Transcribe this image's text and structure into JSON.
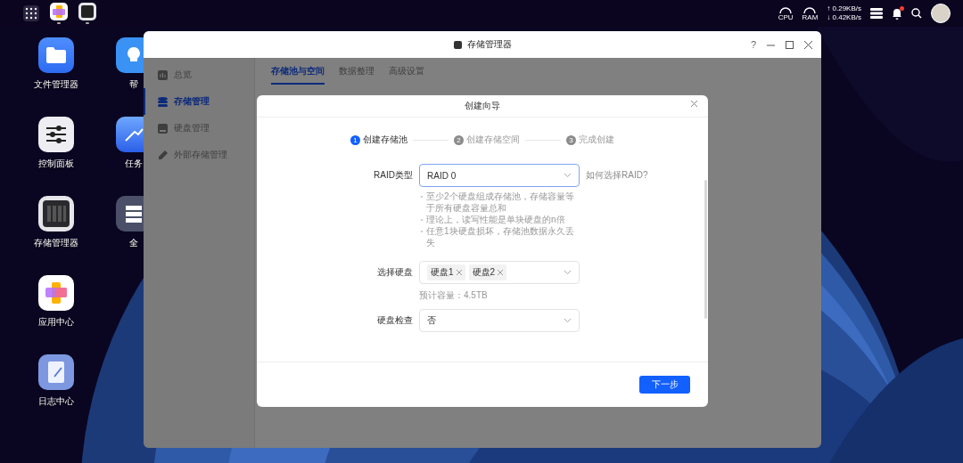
{
  "topbar": {
    "gauges": [
      {
        "label": "CPU"
      },
      {
        "label": "RAM"
      }
    ],
    "net_up": "↑ 0.29KB/s",
    "net_down": "↓ 0.42KB/s",
    "has_notification": true,
    "running_apps": [
      {
        "kind": "apps"
      },
      {
        "kind": "storage"
      }
    ]
  },
  "desktop_icons": [
    {
      "kind": "folder",
      "label": "文件管理器"
    },
    {
      "kind": "help",
      "label": "帮"
    },
    {
      "kind": "sliders",
      "label": "控制面板"
    },
    {
      "kind": "task",
      "label": "任务"
    },
    {
      "kind": "storage",
      "label": "存储管理器"
    },
    {
      "kind": "search",
      "label": "全"
    },
    {
      "kind": "apps",
      "label": "应用中心"
    },
    {
      "kind": "empty"
    },
    {
      "kind": "log",
      "label": "日志中心"
    },
    {
      "kind": "empty"
    }
  ],
  "window": {
    "title": "存储管理器",
    "help_label": "?",
    "sidebar": {
      "items": [
        {
          "label": "总览",
          "selected": false
        },
        {
          "label": "存储管理",
          "selected": true
        },
        {
          "label": "硬盘管理",
          "selected": false
        },
        {
          "label": "外部存储管理",
          "selected": false
        }
      ]
    },
    "tabs": [
      {
        "label": "存储池与空间",
        "selected": true
      },
      {
        "label": "数据整理",
        "selected": false
      },
      {
        "label": "高级设置",
        "selected": false
      }
    ],
    "dialog": {
      "title": "创建向导",
      "steps": [
        {
          "number": "1",
          "label": "创建存储池",
          "active": true
        },
        {
          "number": "2",
          "label": "创建存储空间",
          "active": false
        },
        {
          "number": "3",
          "label": "完成创建",
          "active": false
        }
      ],
      "fields": [
        {
          "kind": "select",
          "label": "RAID类型",
          "value": "RAID 0",
          "focused": true,
          "help_link": "如何选择RAID?",
          "notes": [
            "至少2个硬盘组成存储池，存储容量等于所有硬盘容量总和",
            "理论上，读写性能是单块硬盘的n倍",
            "任意1块硬盘损坏，存储池数据永久丢失"
          ]
        },
        {
          "kind": "multiselect",
          "label": "选择硬盘",
          "tags": [
            "硬盘1",
            "硬盘2"
          ],
          "focused": false,
          "hint": "预计容量：4.5TB"
        },
        {
          "kind": "select",
          "label": "硬盘检查",
          "value": "否",
          "focused": false
        }
      ],
      "next_button": "下一步"
    }
  }
}
